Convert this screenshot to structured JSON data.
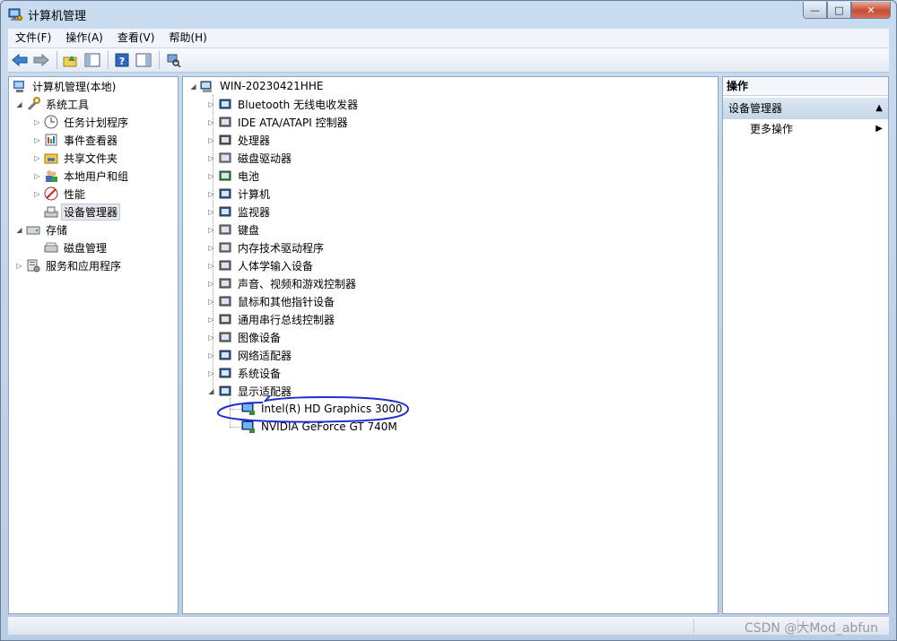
{
  "window": {
    "title": "计算机管理"
  },
  "menu": [
    "文件(F)",
    "操作(A)",
    "查看(V)",
    "帮助(H)"
  ],
  "toolbar": [
    {
      "icon": "back-arrow-icon"
    },
    {
      "icon": "forward-arrow-icon"
    },
    {
      "icon": "up-folder-icon"
    },
    {
      "icon": "show-hide-tree-icon"
    },
    {
      "icon": "help-icon"
    },
    {
      "icon": "show-hide-action-pane-icon"
    },
    {
      "icon": "scan-hardware-icon"
    }
  ],
  "nav_tree": {
    "root": "计算机管理(本地)",
    "system_tools": "系统工具",
    "system_children": [
      "任务计划程序",
      "事件查看器",
      "共享文件夹",
      "本地用户和组",
      "性能",
      "设备管理器"
    ],
    "storage": "存储",
    "storage_children": [
      "磁盘管理"
    ],
    "services": "服务和应用程序"
  },
  "device_tree": {
    "computer_name": "WIN-20230421HHE",
    "categories": [
      "Bluetooth 无线电收发器",
      "IDE ATA/ATAPI 控制器",
      "处理器",
      "磁盘驱动器",
      "电池",
      "计算机",
      "监视器",
      "键盘",
      "内存技术驱动程序",
      "人体学输入设备",
      "声音、视频和游戏控制器",
      "鼠标和其他指针设备",
      "通用串行总线控制器",
      "图像设备",
      "网络适配器",
      "系统设备",
      "显示适配器"
    ],
    "display_adapters": [
      "Intel(R) HD Graphics 3000",
      "NVIDIA GeForce GT 740M"
    ]
  },
  "actions": {
    "header": "操作",
    "section": "设备管理器",
    "more": "更多操作"
  },
  "watermark": "CSDN @大Mod_abfun",
  "colors": {
    "annotation": "#1f2fd0"
  }
}
